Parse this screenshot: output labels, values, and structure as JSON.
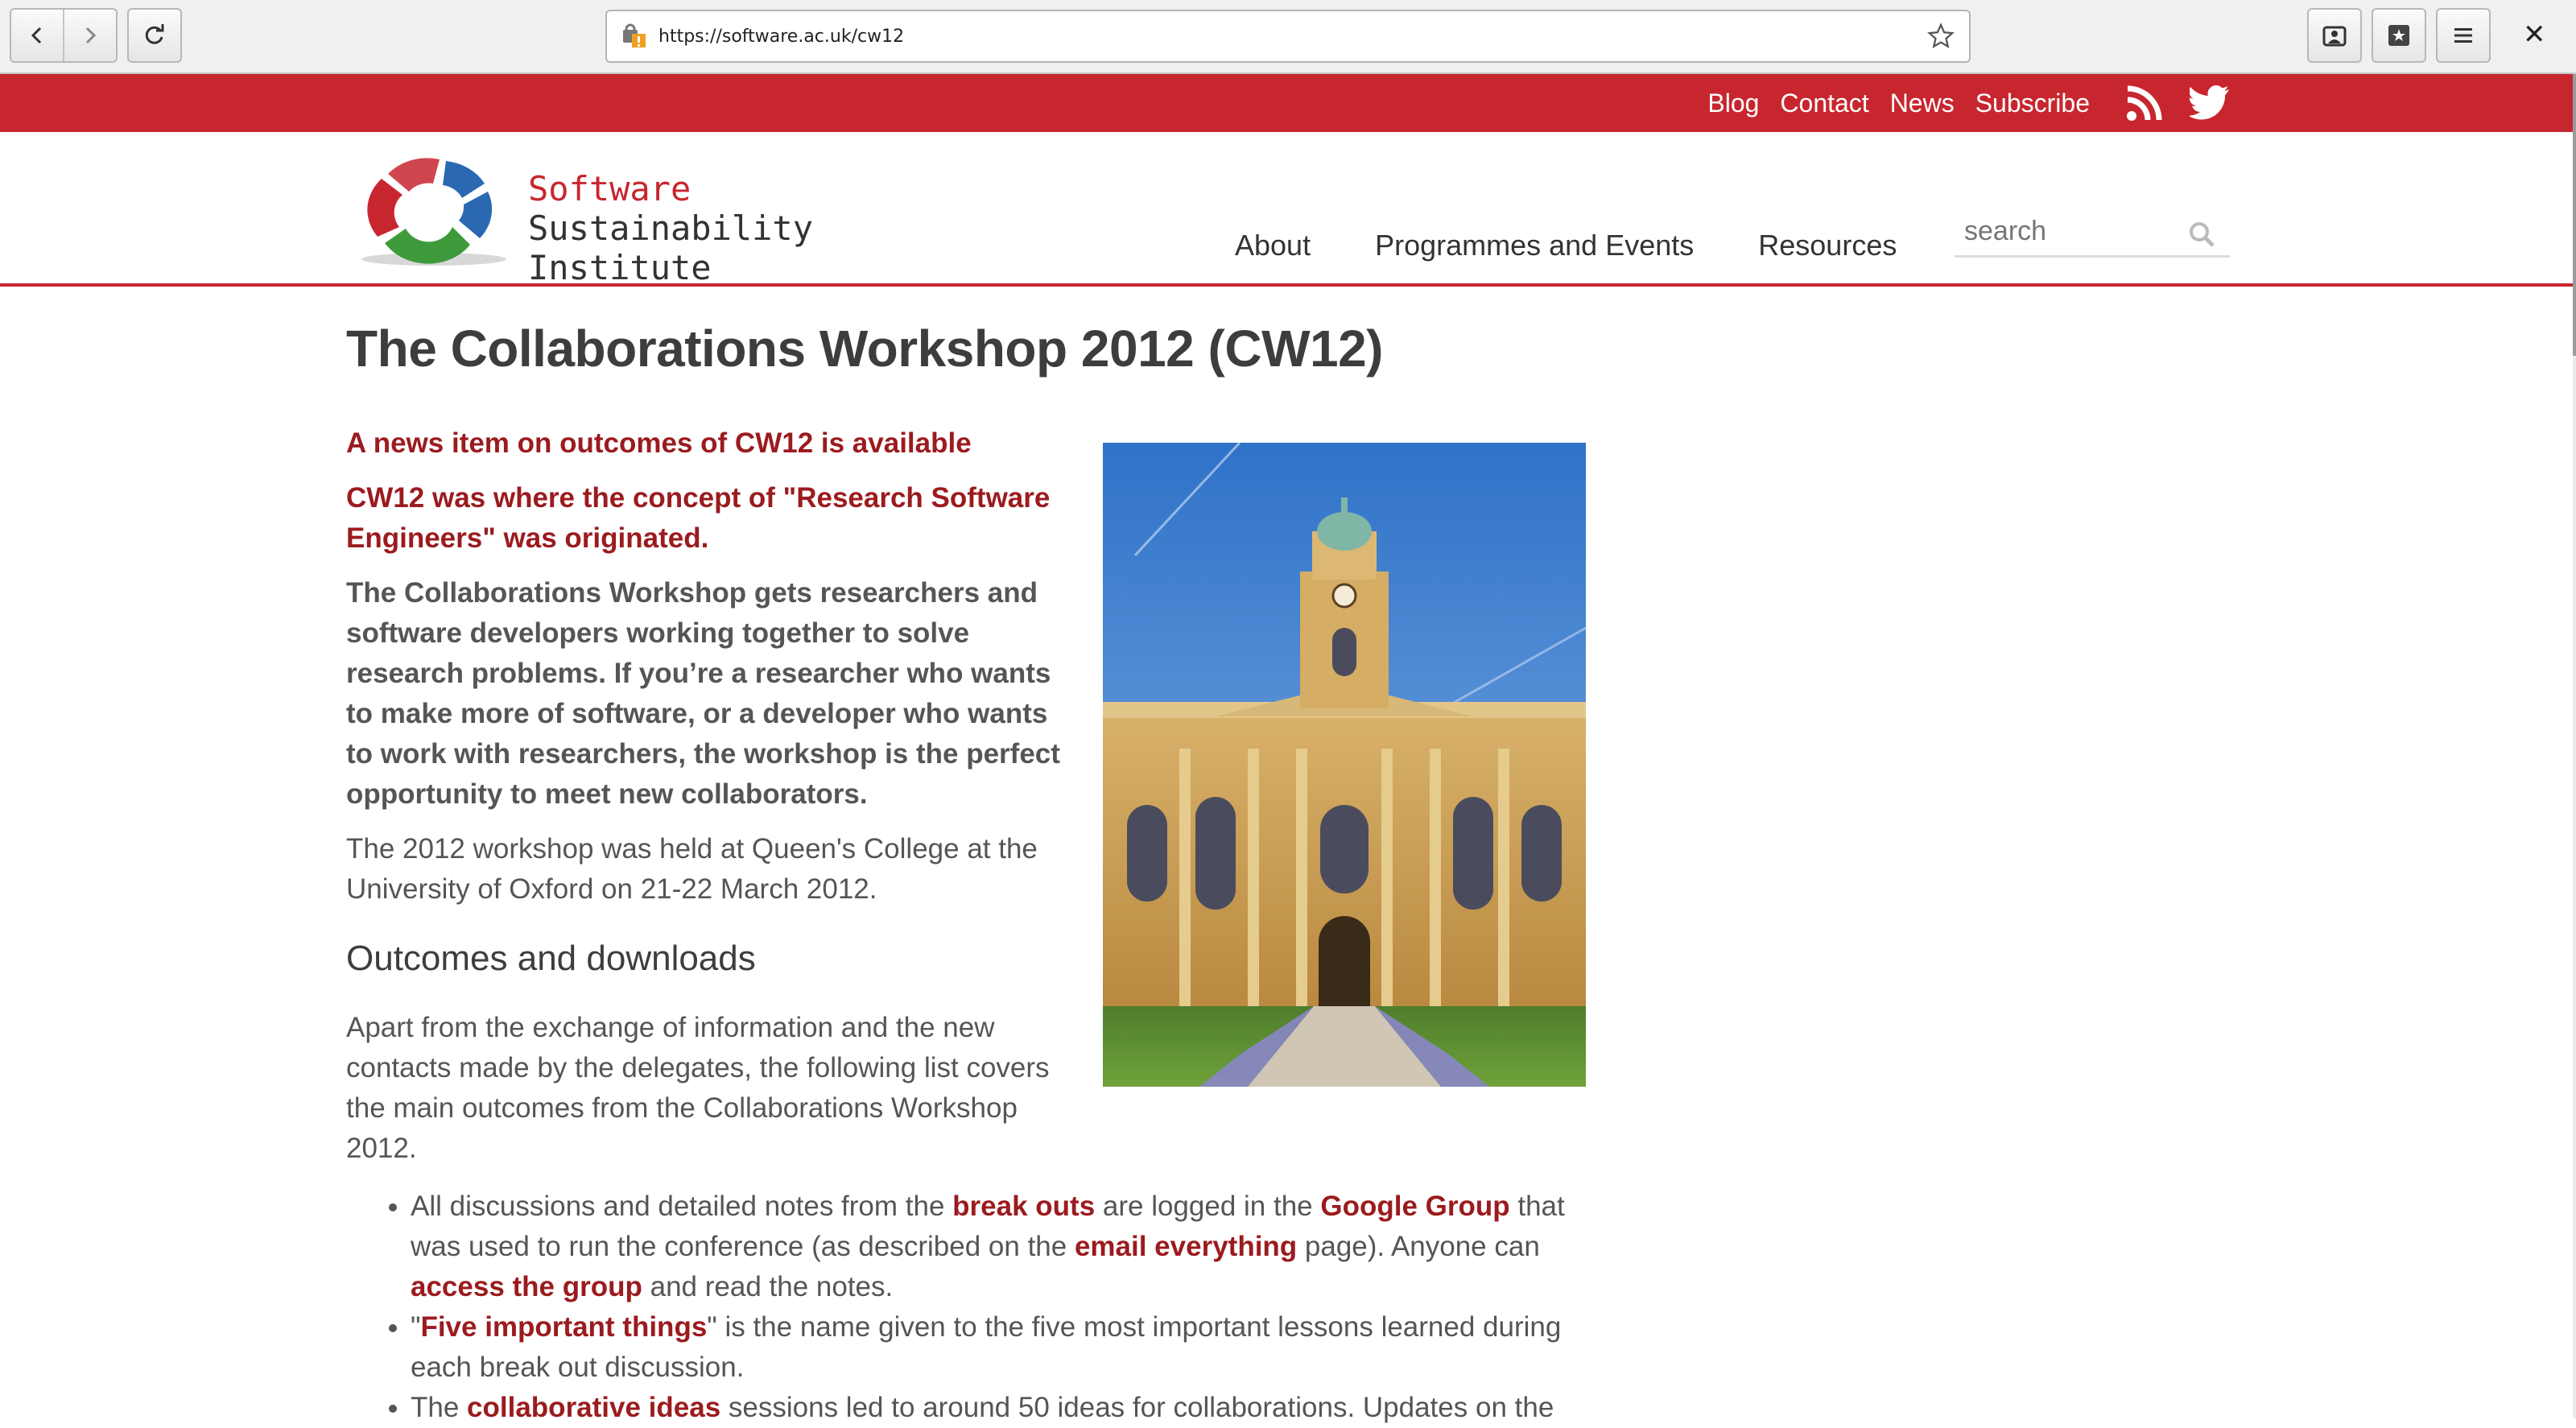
{
  "browser": {
    "url": "https://software.ac.uk/cw12"
  },
  "topbar": {
    "links": [
      "Blog",
      "Contact",
      "News",
      "Subscribe"
    ]
  },
  "site": {
    "logo_line1": "Software",
    "logo_line2": "Sustainability",
    "logo_line3": "Institute",
    "nav": [
      "About",
      "Programmes and Events",
      "Resources"
    ],
    "search_placeholder": "search"
  },
  "page": {
    "title": "The Collaborations Workshop 2012 (CW12)",
    "news_link": "A news item on outcomes of CW12 is available",
    "rse_note": "CW12 was where the concept of \"Research Software Engineers\" was originated.",
    "intro": "The Collaborations Workshop gets researchers and software developers working together to solve research problems. If you’re a researcher who wants to make more of software, or a developer who wants to work with researchers, the workshop is the perfect opportunity to meet new collaborators.",
    "held": "The 2012 workshop was held at Queen's College at the University of Oxford on 21-22 March 2012.",
    "outcomes_heading": "Outcomes and downloads",
    "outcomes_intro": "Apart from the exchange of information and the new contacts made by the delegates, the following list covers the main outcomes from the Collaborations Workshop 2012.",
    "bullets": {
      "b1_t1": "All discussions and detailed notes from the ",
      "b1_l1": "break outs",
      "b1_t2": " are logged in the ",
      "b1_l2": "Google Group",
      "b1_t3": " that was used to run the conference (as described on the ",
      "b1_l3": "email everything",
      "b1_t4": " page). Anyone can ",
      "b1_l4": "access the group",
      "b1_t5": " and read the notes.",
      "b2_t1": "\"",
      "b2_l1": "Five important things",
      "b2_t2": "\" is the name given to the five most important lessons learned during each break out discussion.",
      "b3_t1": "The ",
      "b3_l1": "collaborative ideas",
      "b3_t2": " sessions led to around 50 ideas for collaborations. Updates on the"
    }
  },
  "colors": {
    "brand_red": "#c8262f",
    "link_red": "#9b1b1e"
  },
  "icons": [
    "back-icon",
    "forward-icon",
    "reload-icon",
    "site-info-icon",
    "bookmark-star-icon",
    "user-icon",
    "bookmarks-icon",
    "menu-icon",
    "close-icon",
    "rss-icon",
    "twitter-icon",
    "search-icon"
  ]
}
